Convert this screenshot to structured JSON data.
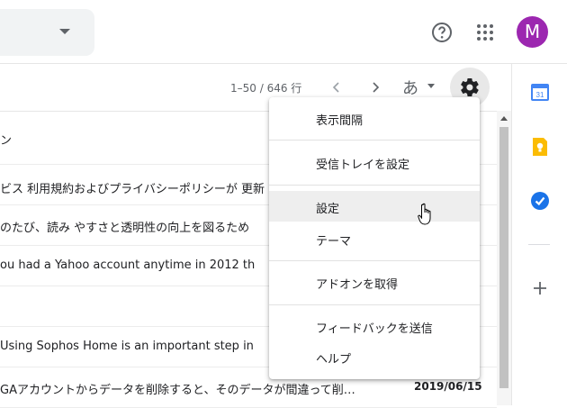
{
  "header": {
    "avatar_letter": "M",
    "icons": [
      "help-icon",
      "apps-icon",
      "chevron-down-icon"
    ]
  },
  "toolbar": {
    "pager": "1–50 / 646 行",
    "ime_label": "あ",
    "icons": [
      "chevron-left-icon",
      "chevron-right-icon",
      "gear-icon"
    ]
  },
  "emails": [
    {
      "snippet": "ン",
      "date": ""
    },
    {
      "snippet": "ビス 利用規約およびプライバシーポリシーが 更新",
      "date": ""
    },
    {
      "snippet": "のたび、読み やすさと透明性の向上を図るため",
      "date": ""
    },
    {
      "snippet": "ou had a Yahoo account anytime in 2012 th",
      "date": ""
    },
    {
      "snippet": "",
      "date": ""
    },
    {
      "snippet": "Using Sophos Home is an important step in",
      "date": ""
    },
    {
      "snippet": "GAアカウントからデータを削除すると、そのデータが間違って削…",
      "date": "2019/06/15"
    }
  ],
  "settings_menu": {
    "items": [
      {
        "label": "表示間隔"
      },
      {
        "label": "受信トレイを設定"
      },
      {
        "label": "設定"
      },
      {
        "label": "テーマ"
      },
      {
        "label": "アドオンを取得"
      },
      {
        "label": "フィードバックを送信"
      },
      {
        "label": "ヘルプ"
      }
    ]
  },
  "side_panel": {
    "icons": [
      "calendar-icon",
      "keep-icon",
      "tasks-icon",
      "plus-icon"
    ],
    "calendar_day": "31"
  },
  "colors": {
    "avatar": "#9c27b0",
    "calendar": "#4285f4",
    "keep": "#fbbc04",
    "tasks": "#1a73e8"
  }
}
